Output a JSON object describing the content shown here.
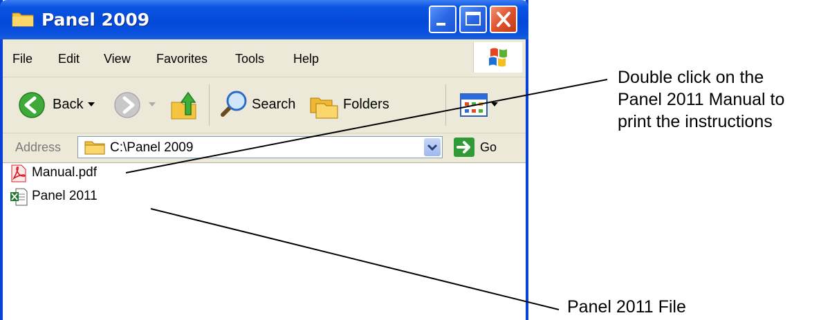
{
  "window": {
    "title": "Panel 2009",
    "menu": [
      "File",
      "Edit",
      "View",
      "Favorites",
      "Tools",
      "Help"
    ],
    "toolbar": {
      "back_label": "Back",
      "search_label": "Search",
      "folders_label": "Folders"
    },
    "address": {
      "label": "Address",
      "value": "C:\\Panel 2009",
      "go_label": "Go"
    },
    "files": [
      {
        "name": "Manual.pdf",
        "icon": "pdf-file-icon"
      },
      {
        "name": "Panel  2011",
        "icon": "excel-file-icon"
      }
    ]
  },
  "callouts": {
    "top": [
      "Double click on the",
      "Panel 2011 Manual to",
      "print the instructions"
    ],
    "bottom": "Panel 2011 File"
  },
  "colors": {
    "titlebar": "#0448d8",
    "chrome": "#ece9d8",
    "close_button": "#e0522e"
  }
}
